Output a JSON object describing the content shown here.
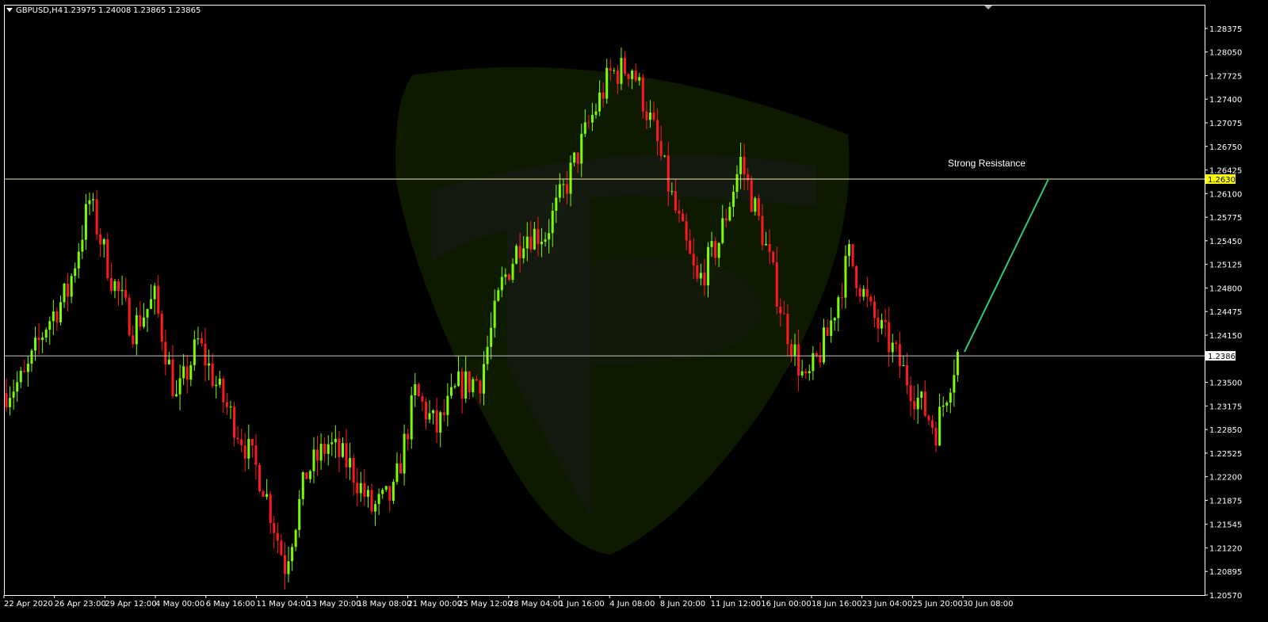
{
  "header": {
    "symbol": "GBPUSD,H4",
    "open": "1.23975",
    "high": "1.24008",
    "low": "1.23865",
    "close": "1.23865"
  },
  "colors": {
    "background": "#000000",
    "bull": "#7CFC00",
    "bear": "#FF1A1A",
    "axis": "#FFFFFF",
    "resistance_line": "#E8E8A0",
    "current_line": "#C8C8C8",
    "projection_line": "#2ECC71",
    "resistance_tag_bg": "#FFFF00",
    "current_tag_bg": "#FFFFFF"
  },
  "price_axis_labels": [
    "1.28375",
    "1.28050",
    "1.27725",
    "1.27400",
    "1.27075",
    "1.26750",
    "1.26425",
    "1.26100",
    "1.25775",
    "1.25450",
    "1.25125",
    "1.24800",
    "1.24475",
    "1.24150",
    "1.23500",
    "1.23175",
    "1.22850",
    "1.22525",
    "1.22200",
    "1.21875",
    "1.21545",
    "1.21220",
    "1.20895",
    "1.20570"
  ],
  "time_axis_labels": [
    "22 Apr 2020",
    "26 Apr 23:00",
    "29 Apr 12:00",
    "4 May 00:00",
    "6 May 16:00",
    "11 May 04:00",
    "13 May 20:00",
    "18 May 08:00",
    "21 May 00:00",
    "25 May 12:00",
    "28 May 04:00",
    "1 Jun 16:00",
    "4 Jun 08:00",
    "8 Jun 20:00",
    "11 Jun 12:00",
    "16 Jun 00:00",
    "18 Jun 16:00",
    "23 Jun 04:00",
    "25 Jun 20:00",
    "30 Jun 08:00"
  ],
  "annotation": {
    "label": "Strong Resistance"
  },
  "resistance_price_label": "1.26300",
  "current_price_label": "1.23865",
  "chart_data": {
    "type": "candlestick",
    "symbol": "GBPUSD",
    "timeframe": "H4",
    "ylim": [
      1.2057,
      1.2869
    ],
    "x_ticks": [
      "22 Apr 2020",
      "26 Apr 23:00",
      "29 Apr 12:00",
      "4 May 00:00",
      "6 May 16:00",
      "11 May 04:00",
      "13 May 20:00",
      "18 May 08:00",
      "21 May 00:00",
      "25 May 12:00",
      "28 May 04:00",
      "1 Jun 16:00",
      "4 Jun 08:00",
      "8 Jun 20:00",
      "11 Jun 12:00",
      "16 Jun 00:00",
      "18 Jun 16:00",
      "23 Jun 04:00",
      "25 Jun 20:00",
      "30 Jun 08:00"
    ],
    "horizontal_lines": [
      {
        "price": 1.263,
        "label": "1.26300",
        "role": "resistance"
      },
      {
        "price": 1.23865,
        "label": "1.23865",
        "role": "current"
      }
    ],
    "projection": {
      "from": {
        "x": "30 Jun 08:00",
        "y": 1.2392
      },
      "to": {
        "y": 1.263
      }
    },
    "annotation": {
      "text": "Strong Resistance",
      "price": 1.263
    },
    "anchor_closes": [
      {
        "x": "22 Apr 2020",
        "y": 1.2335
      },
      {
        "x": "24 Apr",
        "y": 1.2355
      },
      {
        "x": "26 Apr 23:00",
        "y": 1.243
      },
      {
        "x": "28 Apr",
        "y": 1.2475
      },
      {
        "x": "29 Apr 12:00",
        "y": 1.26
      },
      {
        "x": "30 Apr",
        "y": 1.2495
      },
      {
        "x": "4 May 00:00",
        "y": 1.2425
      },
      {
        "x": "5 May",
        "y": 1.2465
      },
      {
        "x": "6 May 16:00",
        "y": 1.2325
      },
      {
        "x": "8 May",
        "y": 1.2405
      },
      {
        "x": "11 May 04:00",
        "y": 1.2335
      },
      {
        "x": "12 May",
        "y": 1.2275
      },
      {
        "x": "13 May 20:00",
        "y": 1.221
      },
      {
        "x": "15 May",
        "y": 1.2098
      },
      {
        "x": "18 May 08:00",
        "y": 1.2225
      },
      {
        "x": "19 May",
        "y": 1.2265
      },
      {
        "x": "21 May 00:00",
        "y": 1.2235
      },
      {
        "x": "22 May",
        "y": 1.2175
      },
      {
        "x": "25 May 12:00",
        "y": 1.2195
      },
      {
        "x": "26 May",
        "y": 1.2335
      },
      {
        "x": "27 May",
        "y": 1.2285
      },
      {
        "x": "28 May 04:00",
        "y": 1.2345
      },
      {
        "x": "29 May",
        "y": 1.2355
      },
      {
        "x": "1 Jun 16:00",
        "y": 1.2485
      },
      {
        "x": "2 Jun",
        "y": 1.2555
      },
      {
        "x": "3 Jun",
        "y": 1.2555
      },
      {
        "x": "4 Jun 08:00",
        "y": 1.2625
      },
      {
        "x": "5 Jun",
        "y": 1.2705
      },
      {
        "x": "8 Jun 20:00",
        "y": 1.2775
      },
      {
        "x": "9 Jun",
        "y": 1.2785
      },
      {
        "x": "10 Jun",
        "y": 1.2695
      },
      {
        "x": "11 Jun 12:00",
        "y": 1.2585
      },
      {
        "x": "12 Jun",
        "y": 1.2485
      },
      {
        "x": "15 Jun",
        "y": 1.2545
      },
      {
        "x": "16 Jun 00:00",
        "y": 1.2655
      },
      {
        "x": "17 Jun",
        "y": 1.2555
      },
      {
        "x": "18 Jun 16:00",
        "y": 1.2435
      },
      {
        "x": "19 Jun",
        "y": 1.2345
      },
      {
        "x": "22 Jun",
        "y": 1.2415
      },
      {
        "x": "23 Jun 04:00",
        "y": 1.2525
      },
      {
        "x": "24 Jun",
        "y": 1.2445
      },
      {
        "x": "25 Jun 20:00",
        "y": 1.2395
      },
      {
        "x": "26 Jun",
        "y": 1.2335
      },
      {
        "x": "29 Jun",
        "y": 1.2285
      },
      {
        "x": "30 Jun 08:00",
        "y": 1.2392
      }
    ]
  }
}
